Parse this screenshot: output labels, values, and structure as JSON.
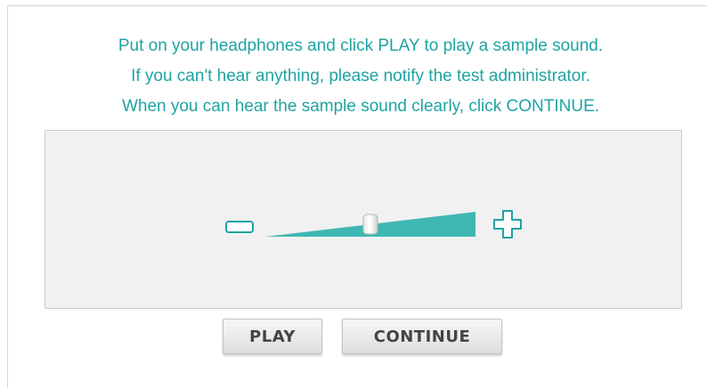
{
  "instructions": {
    "line1": "Put on your headphones and click PLAY to play a sample sound.",
    "line2": "If you can't hear anything, please notify the test administrator.",
    "line3": "When you can hear the sample sound clearly, click CONTINUE."
  },
  "volume": {
    "level": 0.5,
    "decrease_icon": "minus-icon",
    "increase_icon": "plus-icon"
  },
  "buttons": {
    "play_label": "PLAY",
    "continue_label": "CONTINUE"
  },
  "colors": {
    "accent": "#1fa3a3",
    "slider_fill": "#3fb8b3",
    "panel_background": "#f1f1f1"
  }
}
